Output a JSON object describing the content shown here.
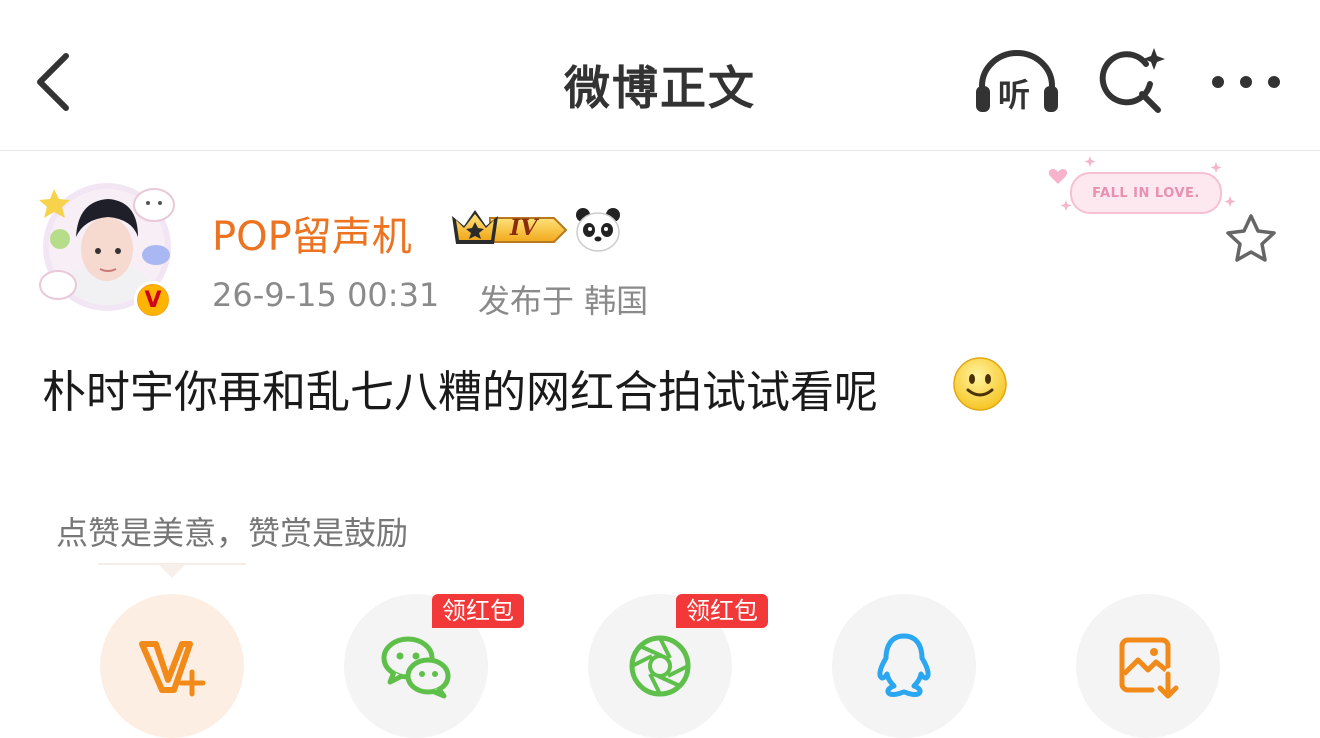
{
  "header": {
    "title": "微博正文",
    "listen_label": "听"
  },
  "post": {
    "author": "POP留声机",
    "level_badge": "IV",
    "time": "26-9-15 00:31",
    "location": "发布于 韩国",
    "decoration_label": "FALL IN LOVE.",
    "text": "朴时宇你再和乱七八糟的网红合拍试试看呢"
  },
  "tip": {
    "text": "点赞是美意，赞赏是鼓励"
  },
  "share": {
    "red_pack_label_1": "领红包",
    "red_pack_label_2": "领红包",
    "items": [
      "vip-reward",
      "wechat",
      "moments",
      "qq",
      "save-image"
    ]
  },
  "colors": {
    "username": "#eb7322",
    "accent_orange": "#f28a1a",
    "wechat_green": "#5ec04a",
    "qq_blue": "#2ba6f0",
    "red_pack": "#f23838"
  }
}
